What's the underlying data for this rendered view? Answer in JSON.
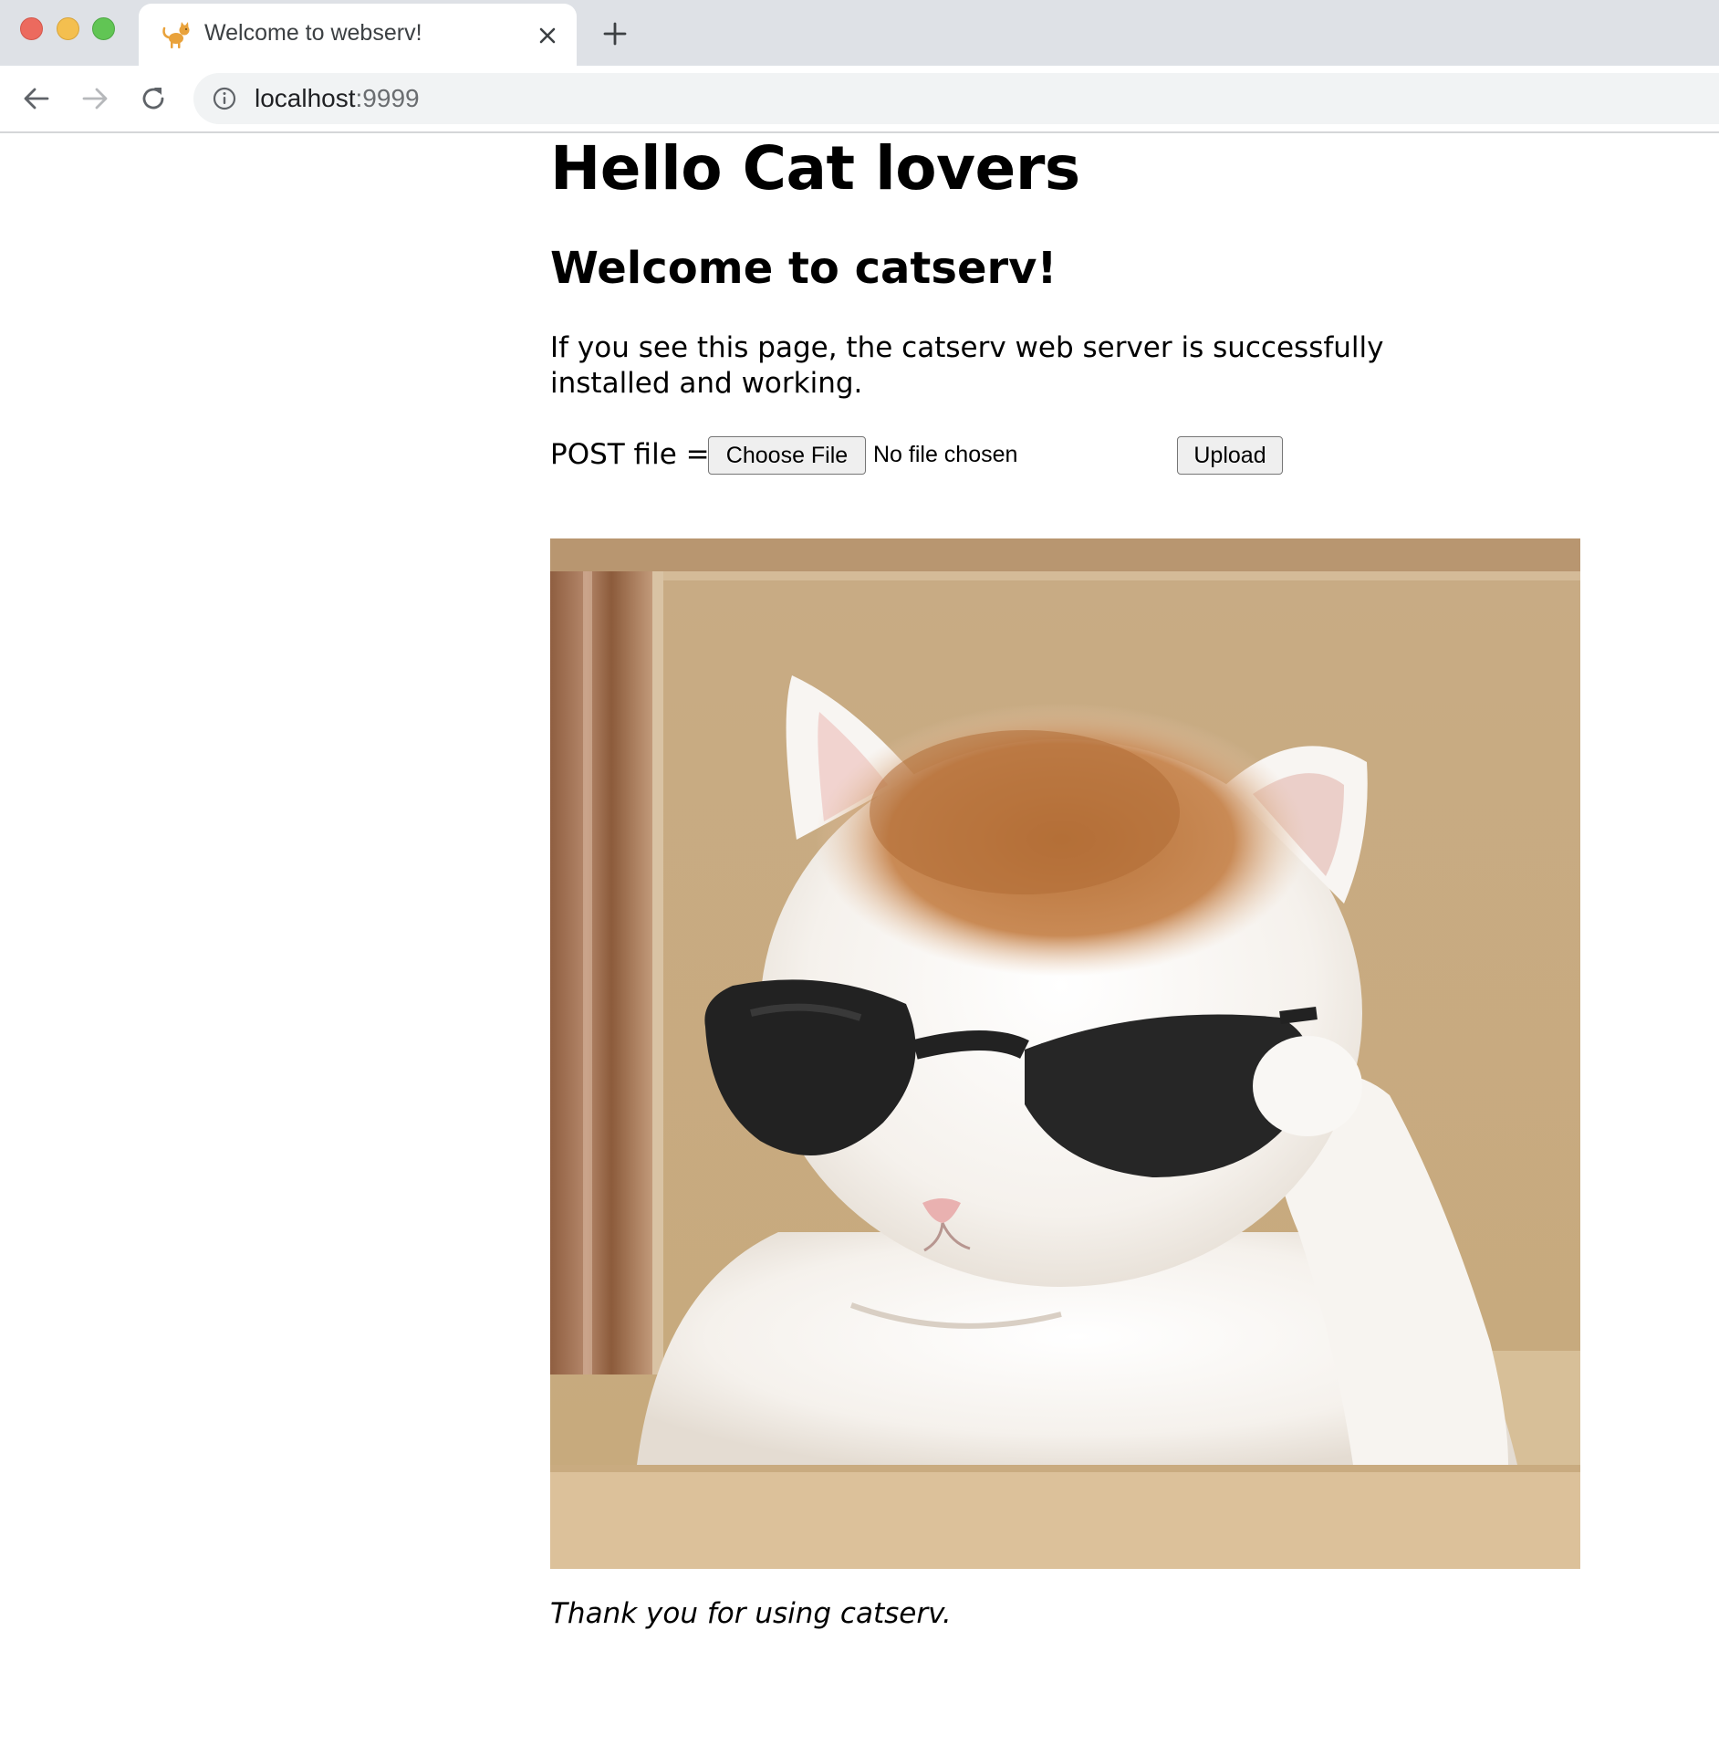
{
  "browser": {
    "tab": {
      "title": "Welcome to webserv!",
      "favicon": "cat-favicon"
    },
    "url": {
      "host": "localhost",
      "port": ":9999"
    }
  },
  "page": {
    "heading": "Hello Cat lovers",
    "subheading": "Welcome to catserv!",
    "description": "If you see this page, the catserv web server is successfully installed and working.",
    "form": {
      "label": "POST file =",
      "file_button": "Choose File",
      "file_status": "No file chosen",
      "submit": "Upload"
    },
    "image": {
      "subject": "white and orange cat wearing black sunglasses"
    },
    "footer": "Thank you for using catserv."
  },
  "colors": {
    "tabbar": "#dee1e6",
    "omnibox": "#f1f3f4",
    "close": "#ec6a5e",
    "minimize": "#f4bf4f",
    "maximize": "#61c554"
  }
}
